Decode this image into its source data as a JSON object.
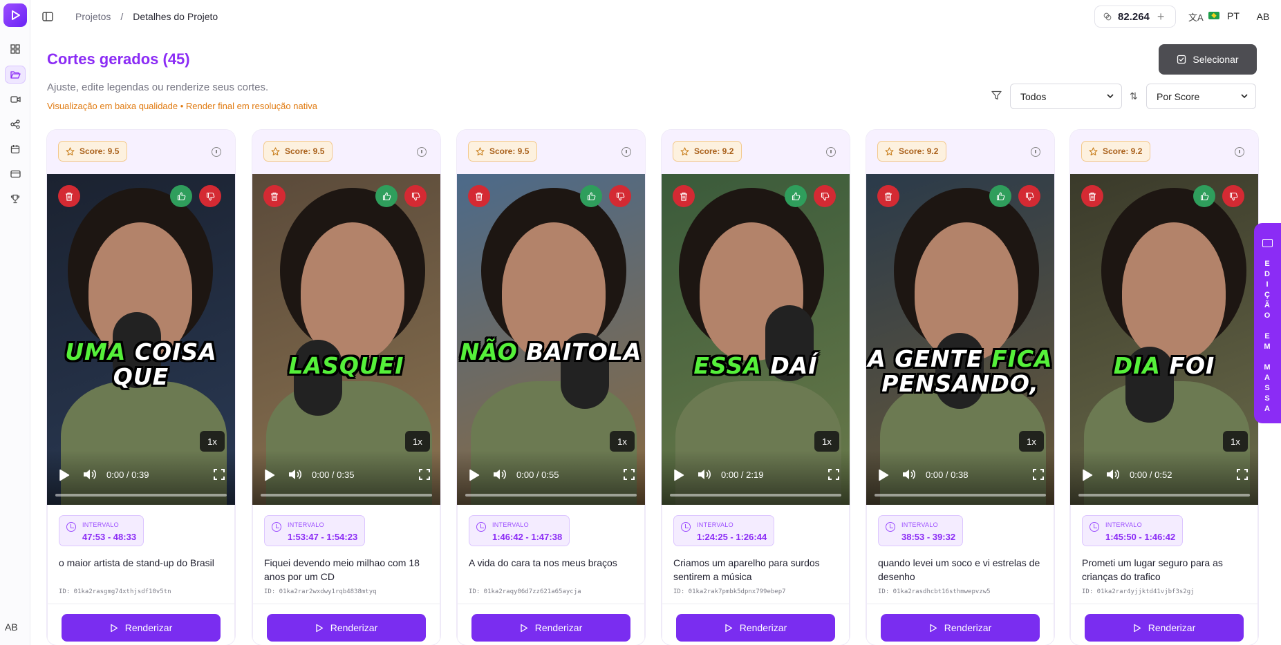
{
  "breadcrumb": {
    "root": "Projetos",
    "separator": "/",
    "current": "Detalhes do Projeto"
  },
  "header": {
    "credits": "82.264",
    "language": "PT",
    "user_initials": "AB"
  },
  "sidebar": {
    "user_initials": "AB"
  },
  "page": {
    "title": "Cortes gerados (45)",
    "subtitle": "Ajuste, edite legendas ou renderize seus cortes.",
    "quality_note": "Visualização em baixa qualidade • Render final em resolução nativa",
    "select_label": "Selecionar",
    "filter_value": "Todos",
    "sort_value": "Por Score"
  },
  "bulk_edit": {
    "label": "EDIÇÃO EM MASSA"
  },
  "labels": {
    "interval": "INTERVALO",
    "render": "Renderizar",
    "speed": "1x"
  },
  "colors": {
    "accent": "#8b2cf5",
    "caption_highlight": "#55f03a",
    "danger": "#d42a33",
    "like": "#2f9e5c"
  },
  "cards": [
    {
      "score": "Score: 9.5",
      "caption_hl": "UMA",
      "caption_rest": " COISA QUE",
      "time": "0:00 / 0:39",
      "interval": "47:53 - 48:33",
      "title": "o maior artista de stand-up do Brasil",
      "id": "ID: 01ka2rasgmg74xthjsdf10v5tn"
    },
    {
      "score": "Score: 9.5",
      "caption_hl": "LASQUEI",
      "caption_rest": "",
      "time": "0:00 / 0:35",
      "interval": "1:53:47 - 1:54:23",
      "title": "Fiquei devendo meio milhao com 18 anos por um CD",
      "id": "ID: 01ka2rar2wxdwy1rqb4838mtyq"
    },
    {
      "score": "Score: 9.5",
      "caption_hl": "NÃO",
      "caption_rest": " BAITOLA",
      "time": "0:00 / 0:55",
      "interval": "1:46:42 - 1:47:38",
      "title": "A vida do cara ta nos meus braços",
      "id": "ID: 01ka2raqy06d7zz621a65aycja"
    },
    {
      "score": "Score: 9.2",
      "caption_hl": "ESSA",
      "caption_rest": " DAÍ",
      "time": "0:00 / 2:19",
      "interval": "1:24:25 - 1:26:44",
      "title": "Criamos um aparelho para surdos sentirem a música",
      "id": "ID: 01ka2rak7pmbk5dpnx799ebep7"
    },
    {
      "score": "Score: 9.2",
      "caption_hl": "FICA",
      "caption_rest": "PENSANDO,",
      "caption_pre": "A GENTE ",
      "time": "0:00 / 0:38",
      "interval": "38:53 - 39:32",
      "title": "quando levei um soco e vi estrelas de desenho",
      "id": "ID: 01ka2rasdhcbt16sthmwepvzw5"
    },
    {
      "score": "Score: 9.2",
      "caption_hl": "DIA",
      "caption_rest": " FOI",
      "time": "0:00 / 0:52",
      "interval": "1:45:50 - 1:46:42",
      "title": "Prometi um lugar seguro para as crianças do trafico",
      "id": "ID: 01ka2rar4yjjktd41vjbf3s2gj"
    }
  ]
}
